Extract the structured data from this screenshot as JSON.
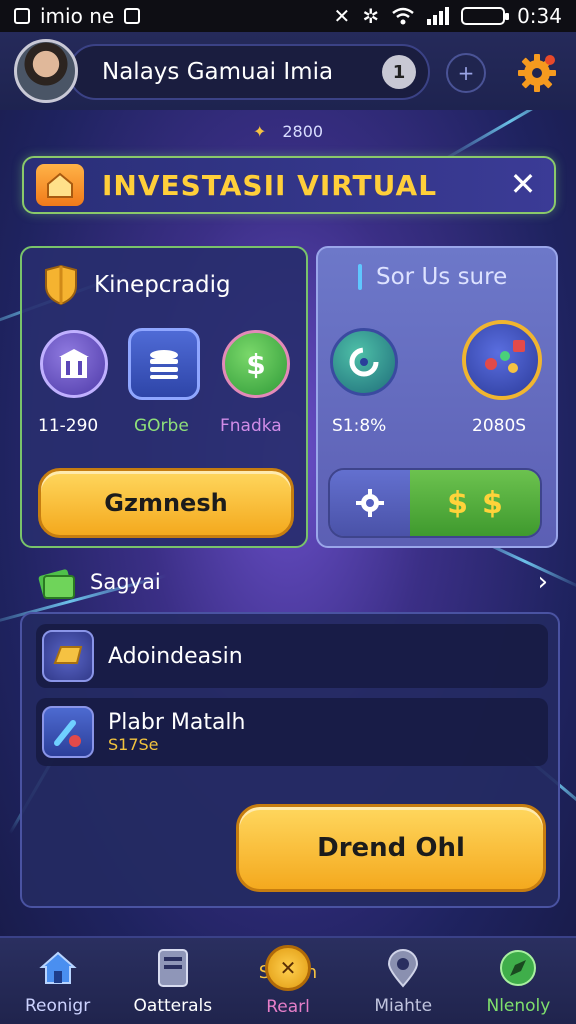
{
  "status_bar": {
    "left_text": "imio ne",
    "time": "0:34"
  },
  "header": {
    "player_name": "Nalays Gamuai Imia",
    "info_label": "1",
    "plus_label": "+"
  },
  "sub_row": {
    "value": "2800"
  },
  "banner": {
    "title": "INVESTASII VIRTUAL",
    "close_label": "✕"
  },
  "left_card": {
    "title": "Kinepcradig",
    "stats": [
      {
        "label": "11-290",
        "color": "#ffffff"
      },
      {
        "label": "GOrbe",
        "color": "#8fe07a"
      },
      {
        "label": "Fnadka",
        "color": "#d08ce8"
      }
    ],
    "button_label": "Gzmnesh"
  },
  "right_card": {
    "title": "Sor Us sure",
    "stats": [
      {
        "label": "S1:8%"
      },
      {
        "label": "2080S"
      }
    ],
    "money_label_1": "$",
    "money_label_2": "$"
  },
  "section": {
    "label": "Sagyai"
  },
  "list": [
    {
      "title": "Adoindeasin",
      "subtitle": ""
    },
    {
      "title": "Plabr Matalh",
      "subtitle": "S17Se"
    }
  ],
  "primary_button": {
    "label": "Drend Ohl"
  },
  "bottom_nav": [
    {
      "label": "Reonigr",
      "icon": "home-icon",
      "color": "#cdd3ff"
    },
    {
      "label": "Oatterals",
      "icon": "tablet-icon",
      "color": "#ffffff"
    },
    {
      "label": "Rearl",
      "icon": "coin-icon",
      "color": "#e67ec8",
      "badge": "Sdr an"
    },
    {
      "label": "Miahte",
      "icon": "map-pin-icon",
      "color": "#c0c4de"
    },
    {
      "label": "Nlenoly",
      "icon": "compass-icon",
      "color": "#7fe06c"
    }
  ],
  "colors": {
    "accent_gold": "#f4a91e",
    "accent_green": "#79c36a",
    "banner_title": "#ffcf3a"
  }
}
